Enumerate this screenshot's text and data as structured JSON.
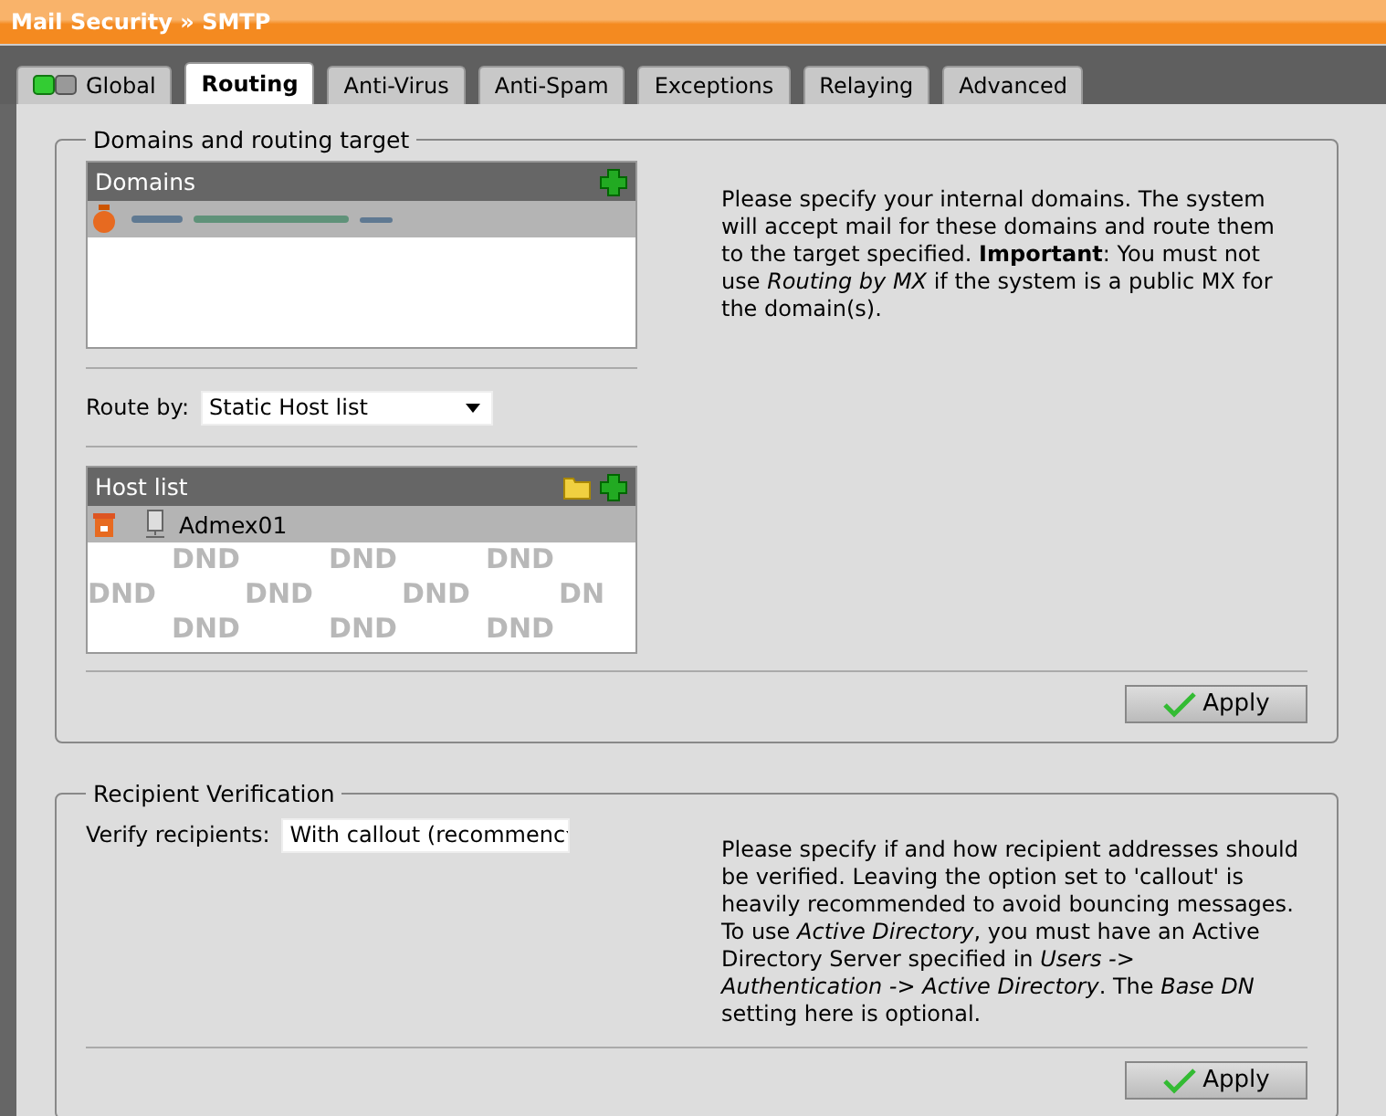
{
  "breadcrumb": "Mail Security » SMTP",
  "tabs": [
    {
      "label": "Global",
      "selected": false,
      "icon": true
    },
    {
      "label": "Routing",
      "selected": true
    },
    {
      "label": "Anti-Virus",
      "selected": false
    },
    {
      "label": "Anti-Spam",
      "selected": false
    },
    {
      "label": "Exceptions",
      "selected": false
    },
    {
      "label": "Relaying",
      "selected": false
    },
    {
      "label": "Advanced",
      "selected": false
    }
  ],
  "routing": {
    "legend": "Domains and routing target",
    "domains": {
      "title": "Domains",
      "rows": [
        {
          "kind": "redacted",
          "selected": true
        }
      ]
    },
    "route_by": {
      "label": "Route by:",
      "value": "Static Host list"
    },
    "host_list": {
      "title": "Host list",
      "rows": [
        {
          "name": "Admex01",
          "selected": true
        }
      ],
      "background_labels": [
        "DND",
        "DND",
        "DND",
        "DND",
        "DND",
        "DND",
        "DN",
        "DND",
        "DND",
        "DND"
      ]
    },
    "help": "Please specify your internal domains. The system will accept mail for these domains and route them to the target specified. **Important**: You must not use *Routing by MX* if the system is a public MX for the domain(s).",
    "apply": "Apply"
  },
  "verification": {
    "legend": "Recipient Verification",
    "verify": {
      "label": "Verify recipients:",
      "value": "With callout (recommenc"
    },
    "help": "Please specify if and how recipient addresses should be verified. Leaving the option set to 'callout' is heavily recommended to avoid bouncing messages. To use *Active Directory*, you must have an Active Directory Server specified in *Users -> Authentication -> Active Directory*. The *Base DN* setting here is optional.",
    "apply": "Apply"
  }
}
